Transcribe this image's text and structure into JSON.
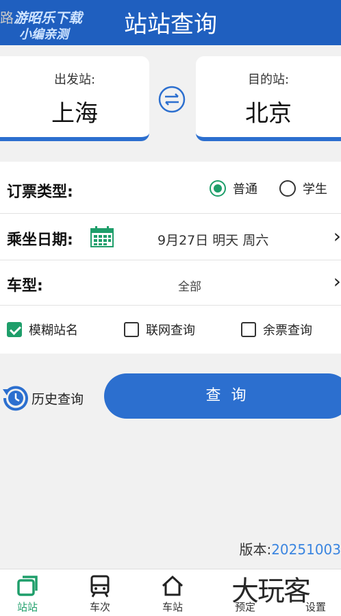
{
  "header": {
    "title": "站站查询",
    "watermark_line1_prefix": "路",
    "watermark_line1": "游昭乐下载",
    "watermark_line2": "小编亲测"
  },
  "stations": {
    "from_label": "出发站:",
    "from_name": "上海",
    "to_label": "目的站:",
    "to_name": "北京"
  },
  "form": {
    "ticket_type_label": "订票类型:",
    "ticket_options": [
      "普通",
      "学生"
    ],
    "ticket_selected": "普通",
    "date_label": "乘坐日期:",
    "date_value": "9月27日 明天 周六",
    "train_type_label": "车型:",
    "train_type_value": "全部",
    "checks": [
      {
        "label": "模糊站名",
        "checked": true
      },
      {
        "label": "联网查询",
        "checked": false
      },
      {
        "label": "余票查询",
        "checked": false
      }
    ]
  },
  "actions": {
    "history_label": "历史查询",
    "query_label": "查 询"
  },
  "version": {
    "label": "版本:",
    "number": "20251003"
  },
  "tabs": [
    "站站",
    "车次",
    "车站",
    "预定",
    "设置"
  ],
  "watermark_bottom": "大玩客",
  "colors": {
    "primary": "#2c6fcf",
    "header": "#1f5fbf",
    "green": "#1e9e6a"
  }
}
